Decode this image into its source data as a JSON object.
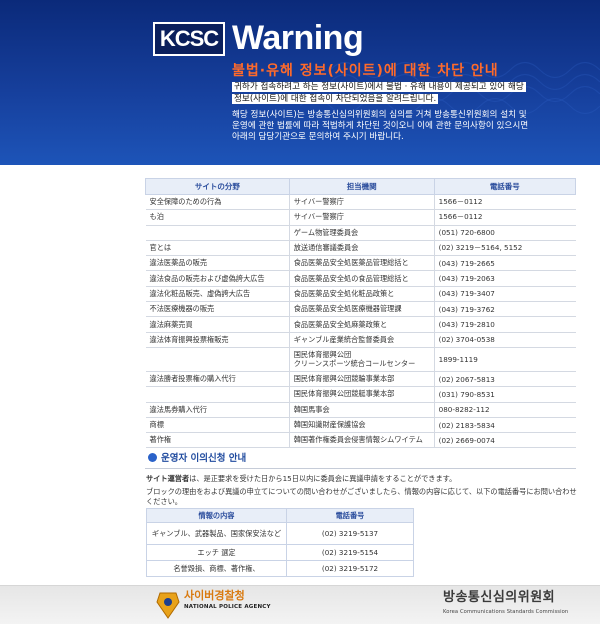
{
  "banner": {
    "logo": "KCSC",
    "warning": "Warning",
    "title": "불법·유해 정보(사이트)에 대한 차단 안내",
    "lines": [
      "귀하가 접속하려고 하는 정보(사이트)에서 불법 · 유해 내용이 제공되고 있어 해당",
      "정보(사이트)에 대한 접속이 차단되었음을 알려드립니다.",
      "해당 정보(사이트)는 방송통신심의위원회의 심의를 거쳐 방송통신위원회의 설치 및",
      "운영에 관한 법률에 따라 적법하게 차단된 것이오니 이에 관한 문의사항이 있으시면",
      "아래의 담당기관으로  문의하여 주시기 바랍니다."
    ]
  },
  "main_table": {
    "headers": [
      "サイトの分野",
      "担当機関",
      "電話番号"
    ],
    "rows": [
      [
        "安全保障のための行為",
        "サイバー警察庁",
        "1566－0112"
      ],
      [
        "も泊",
        "サイバー警察庁",
        "1566－0112"
      ],
      [
        "",
        "ゲーム物管理委員会",
        "(051) 720-6800"
      ],
      [
        "官とは",
        "放送通信審議委員会",
        "(02) 3219－5164, 5152"
      ],
      [
        "違法医薬品の販売",
        "食品医薬品安全処医薬品管理総括と",
        "(043) 719-2665"
      ],
      [
        "違法食品の販売および虚偽誇大広告",
        "食品医薬品安全処の食品管理総括と",
        "(043) 719-2063"
      ],
      [
        "違法化粧品販売、虚偽誇大広告",
        "食品医薬品安全処化粧品政策と",
        "(043) 719-3407"
      ],
      [
        "不法医療機器の販売",
        "食品医薬品安全処医療機器管理課",
        "(043) 719-3762"
      ],
      [
        "違法麻薬売買",
        "食品医薬品安全処麻薬政策と",
        "(043) 719-2810"
      ],
      [
        "違法体育振興投票権販売",
        "ギャンブル産業統合監督委員会",
        "(02) 3704-0538"
      ],
      [
        "",
        "国民体育振興公団\nクリーンスポーツ統合コールセンター",
        "1899-1119"
      ],
      [
        "違法勝者投票権の購入代行",
        "国民体育振興公団競輪事業本部",
        "(02) 2067-5813"
      ],
      [
        "",
        "国民体育振興公団競艇事業本部",
        "(031) 790-8531"
      ],
      [
        "違法馬券購入代行",
        "韓国馬事会",
        "080-8282-112"
      ],
      [
        "商標",
        "韓国知識財産保護協会",
        "(02) 2183-5834"
      ],
      [
        "著作権",
        "韓国著作権委員会侵害情報シムワイテム",
        "(02) 2669-0074"
      ]
    ]
  },
  "operator": {
    "heading": "운영자 이의신청 안내",
    "line1_bold": "サイト運営者",
    "line1_rest": "は、是正要求を受けた日から15日以内に委員会に異議申請をすることができます。",
    "line2": "ブロックの理由をおよび異議の申立てについての問い合わせがございましたら、情報の内容に応じて、以下の電話番号にお問い合わせください。",
    "table_headers": [
      "情報の内容",
      "電話番号"
    ],
    "rows": [
      [
        "ギャンブル、武器製品、国家保安法など",
        "(02) 3219-5137"
      ],
      [
        "エッチ 選定",
        "(02) 3219-5154"
      ],
      [
        "名誉毀損、商標、著作権、",
        "(02) 3219-5172"
      ]
    ]
  },
  "footer": {
    "police_name": "사이버경찰청",
    "police_en": "NATIONAL POLICE AGENCY",
    "kcsc_name": "방송통신심의위원회",
    "kcsc_en": "Korea Communications Standards Commission"
  },
  "colors": {
    "banner_dark": "#0b2a7a",
    "banner_light": "#1d54b8",
    "title_orange": "#ff6a2a",
    "header_blue": "#2d4f9e"
  }
}
